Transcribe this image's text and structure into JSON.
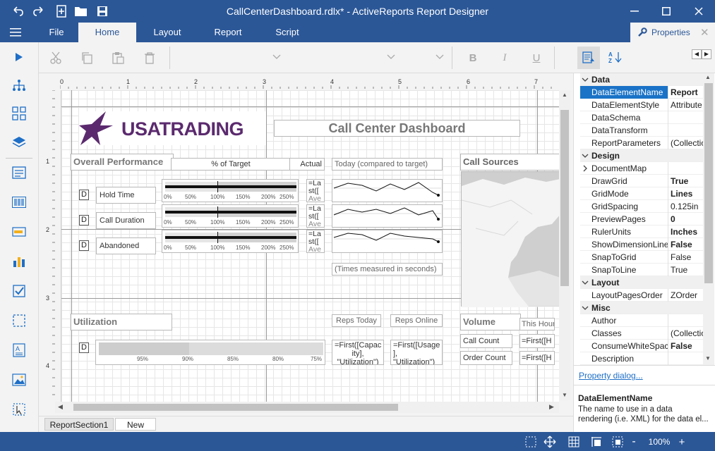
{
  "window": {
    "title": "CallCenterDashboard.rdlx* - ActiveReports Report Designer"
  },
  "menu": {
    "tabs": [
      "File",
      "Home",
      "Layout",
      "Report",
      "Script"
    ],
    "active": "Home"
  },
  "properties_panel": {
    "title": "Properties",
    "rows": [
      {
        "type": "category",
        "name": "Data"
      },
      {
        "type": "prop",
        "name": "DataElementName",
        "value": "Report",
        "bold": true,
        "selected": true
      },
      {
        "type": "prop",
        "name": "DataElementStyle",
        "value": "Attribute",
        "bold": false
      },
      {
        "type": "prop",
        "name": "DataSchema",
        "value": "",
        "bold": false
      },
      {
        "type": "prop",
        "name": "DataTransform",
        "value": "",
        "bold": false
      },
      {
        "type": "prop",
        "name": "ReportParameters",
        "value": "(Collection)",
        "bold": false
      },
      {
        "type": "category",
        "name": "Design"
      },
      {
        "type": "prop",
        "name": "DocumentMap",
        "value": "",
        "bold": false,
        "expandable": true
      },
      {
        "type": "prop",
        "name": "DrawGrid",
        "value": "True",
        "bold": true
      },
      {
        "type": "prop",
        "name": "GridMode",
        "value": "Lines",
        "bold": true
      },
      {
        "type": "prop",
        "name": "GridSpacing",
        "value": "0.125in",
        "bold": false
      },
      {
        "type": "prop",
        "name": "PreviewPages",
        "value": "0",
        "bold": true
      },
      {
        "type": "prop",
        "name": "RulerUnits",
        "value": "Inches",
        "bold": true
      },
      {
        "type": "prop",
        "name": "ShowDimensionLines",
        "value": "False",
        "bold": true
      },
      {
        "type": "prop",
        "name": "SnapToGrid",
        "value": "False",
        "bold": false
      },
      {
        "type": "prop",
        "name": "SnapToLine",
        "value": "True",
        "bold": false
      },
      {
        "type": "category",
        "name": "Layout"
      },
      {
        "type": "prop",
        "name": "LayoutPagesOrder",
        "value": "ZOrder",
        "bold": false
      },
      {
        "type": "category",
        "name": "Misc"
      },
      {
        "type": "prop",
        "name": "Author",
        "value": "",
        "bold": false
      },
      {
        "type": "prop",
        "name": "Classes",
        "value": "(Collection)",
        "bold": false
      },
      {
        "type": "prop",
        "name": "ConsumeWhiteSpace",
        "value": "False",
        "bold": true
      },
      {
        "type": "prop",
        "name": "Description",
        "value": "",
        "bold": false
      }
    ],
    "dialog_link": "Property dialog...",
    "desc_title": "DataElementName",
    "desc_text_1": "The name to use in a data",
    "desc_text_2": "rendering (i.e. XML) for the data el..."
  },
  "report": {
    "logo_text": "USATRADING",
    "title": "Call Center Dashboard",
    "overall_performance": "Overall Performance",
    "pct_target": "% of Target",
    "actual": "Actual",
    "today": "Today (compared to target)",
    "call_sources": "Call Sources",
    "d": "D",
    "rows": [
      "Hold Time",
      "Call Duration",
      "Abandoned"
    ],
    "scale": [
      "0%",
      "50%",
      "100%",
      "150%",
      "200%",
      "250%"
    ],
    "expr1": "=La",
    "expr2": "st([",
    "expr3": "Ave",
    "times_note": "(Times measured in seconds)",
    "utilization": "Utilization",
    "reps_today": "Reps Today",
    "reps_online": "Reps Online",
    "volume": "Volume",
    "this_hour": "This Hour",
    "util_scale": [
      "95%",
      "90%",
      "85%",
      "80%",
      "75%"
    ],
    "capacity_expr_1": "=First([Capac",
    "capacity_expr_2": "ity],",
    "capacity_expr_3": "\"Utilization\")",
    "usage_expr_1": "=First([Usage",
    "usage_expr_2": "], \"Utilization\")",
    "call_count": "Call Count",
    "order_count": "Order Count",
    "first_h": "=First([H"
  },
  "hruler_labels": [
    "0",
    "1",
    "2",
    "3",
    "4",
    "5",
    "6",
    "7"
  ],
  "vruler_labels": [
    "1",
    "2",
    "3",
    "4"
  ],
  "section_tabs": [
    "ReportSection1",
    "New"
  ],
  "status": {
    "zoom": "100%"
  }
}
